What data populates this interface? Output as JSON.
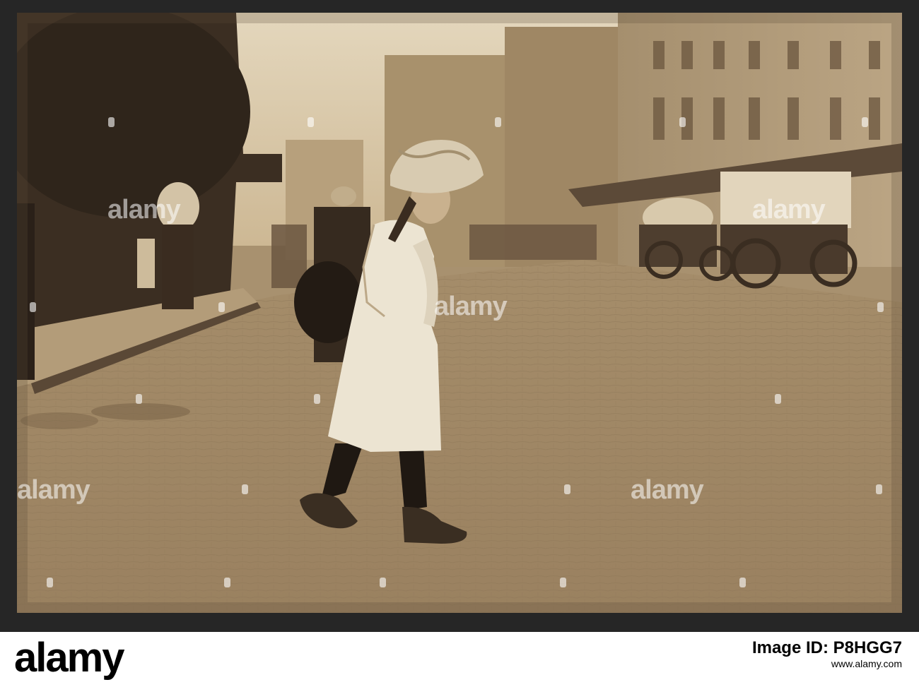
{
  "image": {
    "description_colors": {
      "sepia_light": "#d9c6a3",
      "sepia_mid": "#a8916f",
      "sepia_dark": "#3b2e22",
      "frame": "#262626"
    }
  },
  "watermark": {
    "text": "alamy"
  },
  "footer": {
    "logo_text": "alamy",
    "image_id_label": "Image ID: P8HGG7",
    "site": "www.alamy.com"
  }
}
